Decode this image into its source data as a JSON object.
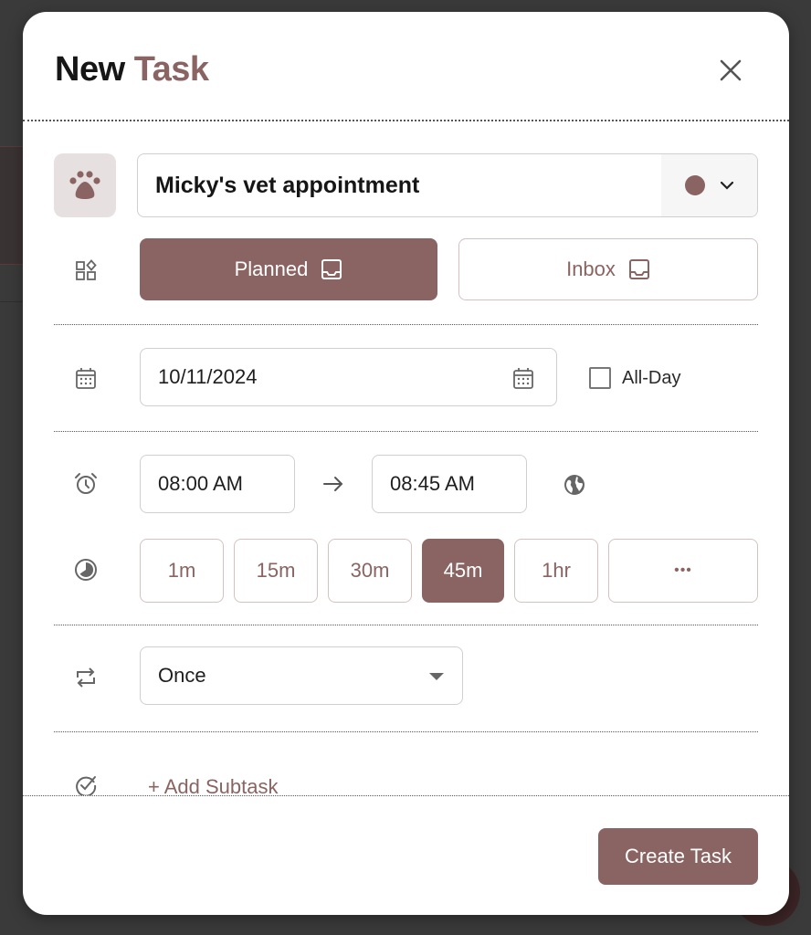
{
  "dialog": {
    "title_prefix": "New",
    "title_accent": "Task",
    "close_icon": "close-icon"
  },
  "task": {
    "emoji_icon": "paw-icon",
    "name_value": "Micky's vet appointment",
    "color": "#8a6462",
    "color_picker_icon": "chevron-down-icon"
  },
  "type": {
    "icon": "category-icon",
    "options": [
      {
        "label": "Planned",
        "icon": "inbox-icon",
        "selected": true
      },
      {
        "label": "Inbox",
        "icon": "inbox-icon",
        "selected": false
      }
    ]
  },
  "date": {
    "icon": "calendar-icon",
    "value": "10/11/2024",
    "all_day_label": "All-Day",
    "all_day_checked": false
  },
  "time": {
    "icon": "alarm-clock-icon",
    "start": "08:00 AM",
    "end": "08:45 AM",
    "arrow_icon": "arrow-right-icon",
    "timezone_icon": "globe-icon"
  },
  "duration": {
    "icon": "clock-pie-icon",
    "options": [
      "1m",
      "15m",
      "30m",
      "45m",
      "1hr",
      "•••"
    ],
    "selected": "45m"
  },
  "repeat": {
    "icon": "repeat-icon",
    "value": "Once"
  },
  "subtasks": {
    "icon": "check-circle-icon",
    "add_label": "+ Add Subtask"
  },
  "footer": {
    "create_label": "Create Task"
  },
  "colors": {
    "accent": "#8a6462",
    "accent_light": "#e7e0e0",
    "border": "#cfcfcf"
  }
}
